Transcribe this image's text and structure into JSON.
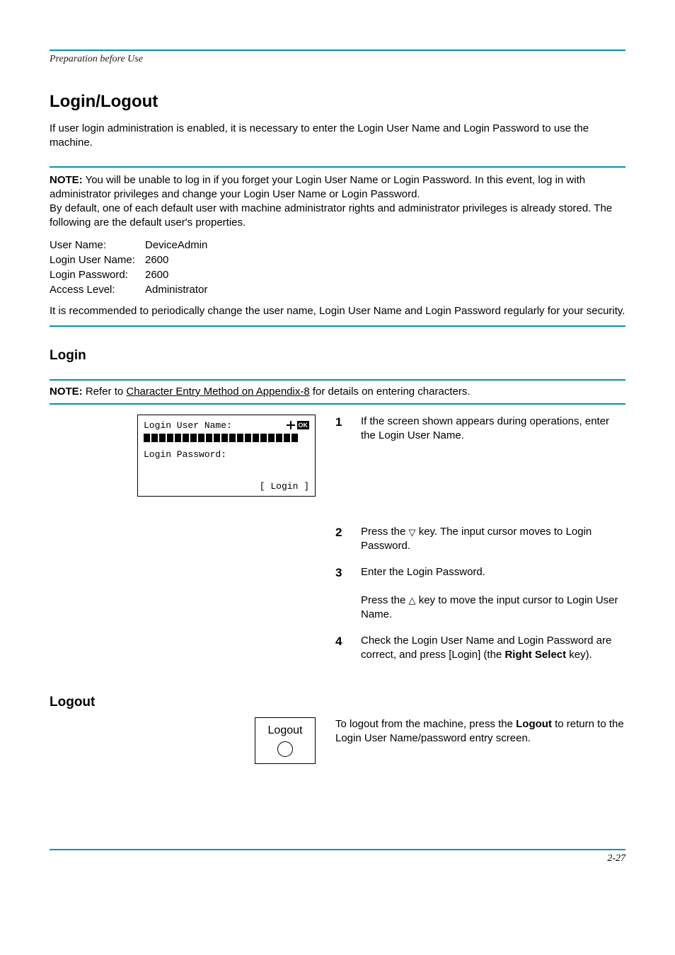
{
  "running_head": {
    "left": "Preparation before Use",
    "right": ""
  },
  "title": "Login/Logout",
  "intro": "If user login administration is enabled, it is necessary to enter the Login User Name and Login Password to use the machine.",
  "note1": {
    "label": "NOTE:",
    "line1": "You will be unable to log in if you forget your Login User Name or Login Password. In this event, log in with administrator privileges and change your Login User Name or Login Password.",
    "line2": "By default, one of each default user with machine administrator rights and administrator privileges is already stored. The following are the default user's properties.",
    "props": [
      {
        "k": "User Name:",
        "v": "DeviceAdmin"
      },
      {
        "k": "Login User Name:",
        "v": "2600"
      },
      {
        "k": "Login Password:",
        "v": "2600"
      },
      {
        "k": "Access Level:",
        "v": "Administrator"
      }
    ],
    "line3": "It is recommended to periodically change the user name, Login User Name and Login Password regularly for your security."
  },
  "login": {
    "heading": "Login",
    "note_label": "NOTE:",
    "note_text_pre": "Refer to ",
    "note_link": "Character Entry Method on Appendix-8",
    "note_text_post": " for details on entering characters.",
    "screen": {
      "title": "Login User Name:",
      "ok": "OK",
      "password_label": "Login Password:",
      "fn_left": "",
      "fn_right": "[  Login  ]"
    },
    "steps": [
      "If the screen shown appears during operations, enter the Login User Name.",
      "Press the ▽ key. The input cursor moves to Login Password.",
      "Enter the Login Password.\nPress the △ key to move the input cursor to Login User Name.",
      "Check the Login User Name and Login Password are correct, and press [Login] (the Right Select key)."
    ]
  },
  "logout": {
    "heading": "Logout",
    "button_label": "Logout",
    "text_a": "To logout from the machine, press the ",
    "text_b": "Logout",
    "text_c": " to return to the Login User Name/password entry screen."
  },
  "page_number": "2-27"
}
